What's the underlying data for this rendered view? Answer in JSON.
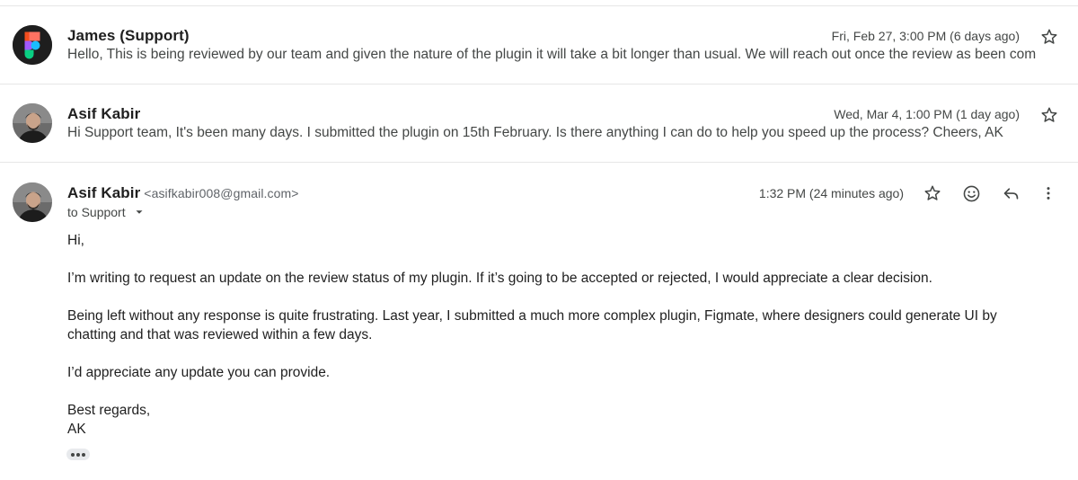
{
  "messages": [
    {
      "sender": "James (Support)",
      "date": "Fri, Feb 27, 3:00 PM (6 days ago)",
      "snippet": "Hello, This is being reviewed by our team and given the nature of the plugin it will take a bit longer than usual. We will reach out once the review as been com",
      "avatar": "figma-logo-icon"
    },
    {
      "sender": "Asif Kabir",
      "date": "Wed, Mar 4, 1:00 PM (1 day ago)",
      "snippet": "Hi Support team, It's been many days. I submitted the plugin on 15th February. Is there anything I can do to help you speed up the process? Cheers, AK",
      "avatar": "user-photo-icon"
    }
  ],
  "open_message": {
    "sender": "Asif Kabir",
    "email": "<asifkabir008@gmail.com>",
    "date": "1:32 PM (24 minutes ago)",
    "to": "to Support",
    "body": {
      "greeting": "Hi,",
      "p1": "I’m writing to request an update on the review status of my plugin. If it’s going to be accepted or rejected, I would appreciate a clear decision.",
      "p2": "Being left without any response is quite frustrating. Last year, I submitted a much more complex plugin, Figmate, where designers could generate UI by chatting and that was reviewed within a few days.",
      "p3": "I’d appreciate any update you can provide.",
      "closing": "Best regards,",
      "signature": "AK"
    }
  },
  "colors": {
    "text_primary": "#1f1f1f",
    "text_secondary": "#444746",
    "divider": "#e6e6e6"
  }
}
